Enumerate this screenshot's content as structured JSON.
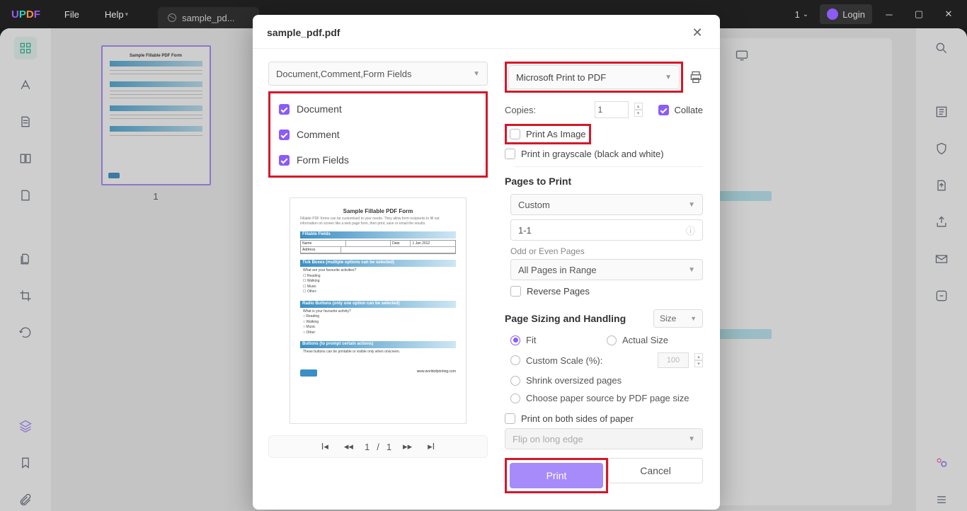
{
  "topbar": {
    "logo_letters": [
      "U",
      "P",
      "D",
      "F"
    ],
    "file": "File",
    "help": "Help",
    "tab_label": "sample_pd...",
    "count_badge": "1",
    "login": "Login"
  },
  "thumbnail": {
    "page_number": "1"
  },
  "dialog": {
    "title": "sample_pdf.pdf",
    "content_combo": "Document,Comment,Form Fields",
    "content_options": {
      "document": "Document",
      "comment": "Comment",
      "form_fields": "Form Fields"
    },
    "preview": {
      "title": "Sample Fillable PDF Form",
      "subtitle": "Fillable PDF forms can be customised to your needs. They allow form recipients to fill out information on screen like a web page form, then print, save or email the results.",
      "sec1": "Fillable Fields",
      "name_lbl": "Name",
      "date_lbl": "Date",
      "date_val": "1    Jan    2012",
      "addr_lbl": "Address",
      "sec2": "Tick Boxes (multiple options can be selected)",
      "q2": "What are your favourite activities?",
      "opts2": "☐ Reading\n☐ Walking\n☐ Music\n☐ Other",
      "sec3": "Radio Buttons (only one option can be selected)",
      "q3": "What is your favourite activity?",
      "opts3": "○ Reading\n○ Walking\n○ Music\n○ Other",
      "sec4": "Buttons (to prompt certain actions)",
      "note4": "These buttons can be printable or visible only when onscreen.",
      "footer_url": "www.worldofprinting.com"
    },
    "preview_cut": "",
    "pager": {
      "current": "1",
      "sep": "/",
      "total": "1"
    },
    "printer": "Microsoft Print to PDF",
    "copies_label": "Copies:",
    "copies_value": "1",
    "collate": "Collate",
    "print_as_image": "Print As Image",
    "grayscale": "Print in grayscale (black and white)",
    "pages_to_print": "Pages to Print",
    "range_mode": "Custom",
    "range_value": "1-1",
    "odd_even_label": "Odd or Even Pages",
    "odd_even_value": "All Pages in Range",
    "reverse_pages": "Reverse Pages",
    "sizing_title": "Page Sizing and Handling",
    "size_mode": "Size",
    "scale": {
      "fit": "Fit",
      "actual": "Actual Size",
      "custom": "Custom Scale (%):",
      "custom_val": "100",
      "shrink": "Shrink oversized pages",
      "source": "Choose paper source by PDF page size"
    },
    "duplex": "Print on both sides of paper",
    "flip": "Flip on long edge",
    "btn_print": "Print",
    "btn_cancel": "Cancel"
  }
}
